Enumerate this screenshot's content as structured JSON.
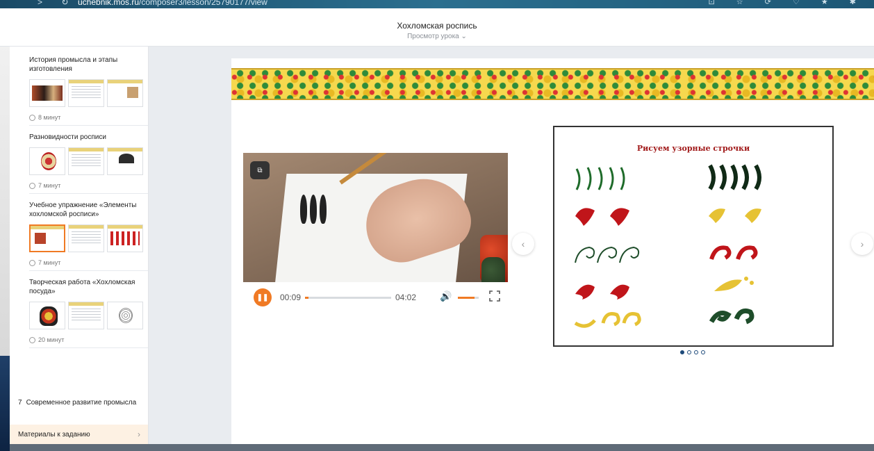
{
  "browser": {
    "nav_glyphs": "> ↻",
    "url_prefix": "uchebnik.mos.ru",
    "url_path": "/composer3/lesson/25790177/view",
    "tool_glyphs": "⊡ ☆ ⟳ ♡ ★ ✱"
  },
  "header": {
    "title": "Хохломская роспись",
    "subtitle": "Просмотр урока ⌄"
  },
  "sidebar": {
    "lessons": [
      {
        "title": "История промысла и этапы изготовления",
        "duration": "8 минут"
      },
      {
        "title": "Разновидности росписи",
        "duration": "7 минут"
      },
      {
        "title": "Учебное упражнение «Элементы хохломской росписи»",
        "duration": "7 минут"
      },
      {
        "title": "Творческая работа «Хохломская посуда»",
        "duration": "20 минут"
      }
    ],
    "item7": {
      "number": "7",
      "title": "Современное развитие промысла"
    },
    "materials": {
      "label": "Материалы к заданию",
      "chevron": "›"
    }
  },
  "video": {
    "current_time": "00:09",
    "total_time": "04:02",
    "progress": 0.037,
    "volume": 0.8,
    "play_state_glyph": "❚❚",
    "pip_glyph": "⧉",
    "volume_glyph": "🔊"
  },
  "slide": {
    "title": "Рисуем узорные строчки",
    "nav_prev": "‹",
    "nav_next": "›",
    "pager": {
      "count": 4,
      "active_index": 0
    }
  },
  "colors": {
    "accent": "#f07a24",
    "khokhloma_red": "#c0151a",
    "khokhloma_gold": "#e6c234",
    "khokhloma_green": "#1e4d2a",
    "pager": "#1e4a7a"
  }
}
